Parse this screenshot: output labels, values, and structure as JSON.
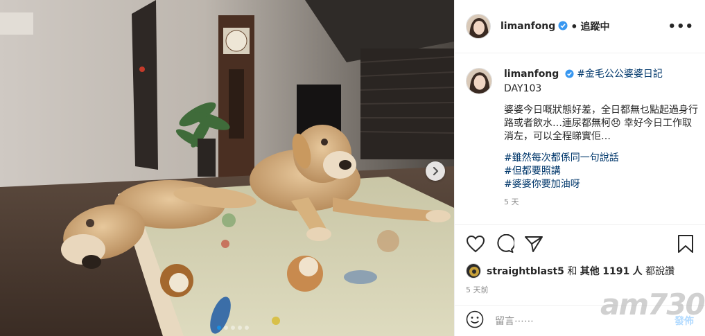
{
  "post": {
    "account": {
      "username": "limanfong",
      "follow_status": "追蹤中",
      "separator": "•",
      "more": "•••"
    },
    "caption": {
      "username": "limanfong",
      "hashtag_title": "#金毛公公婆婆日記",
      "day": "DAY103",
      "body": "婆婆今日嘅狀態好差，全日都無乜點起過身行路或者飲水…連尿都無柯😞 幸好今日工作取消左，可以全程睇實佢…",
      "hashtags": [
        "#雖然每次都係同一句說話",
        "#但都要照講",
        "#婆婆你要加油呀"
      ],
      "time_ago": "5 天"
    },
    "likes": {
      "first_user": "straightblast5",
      "and": "和",
      "others_label": "其他",
      "count": "1191",
      "suffix": "人",
      "action": "都說讚"
    },
    "date": "5 天前",
    "comment_box": {
      "placeholder": "留言⋯⋯",
      "submit": "發佈"
    },
    "carousel": {
      "total": 5,
      "active": 1
    },
    "watermark": "am730"
  },
  "colors": {
    "verified": "#3897f0",
    "link": "#00376b",
    "post_disabled": "#b3dbff",
    "secondary_text": "#8e8e8e",
    "active_dot": "#1a8fe3"
  },
  "icons": [
    "verified-icon",
    "heart-icon",
    "comment-icon",
    "share-icon",
    "bookmark-icon",
    "emoji-icon",
    "chevron-right-icon",
    "more-icon"
  ]
}
